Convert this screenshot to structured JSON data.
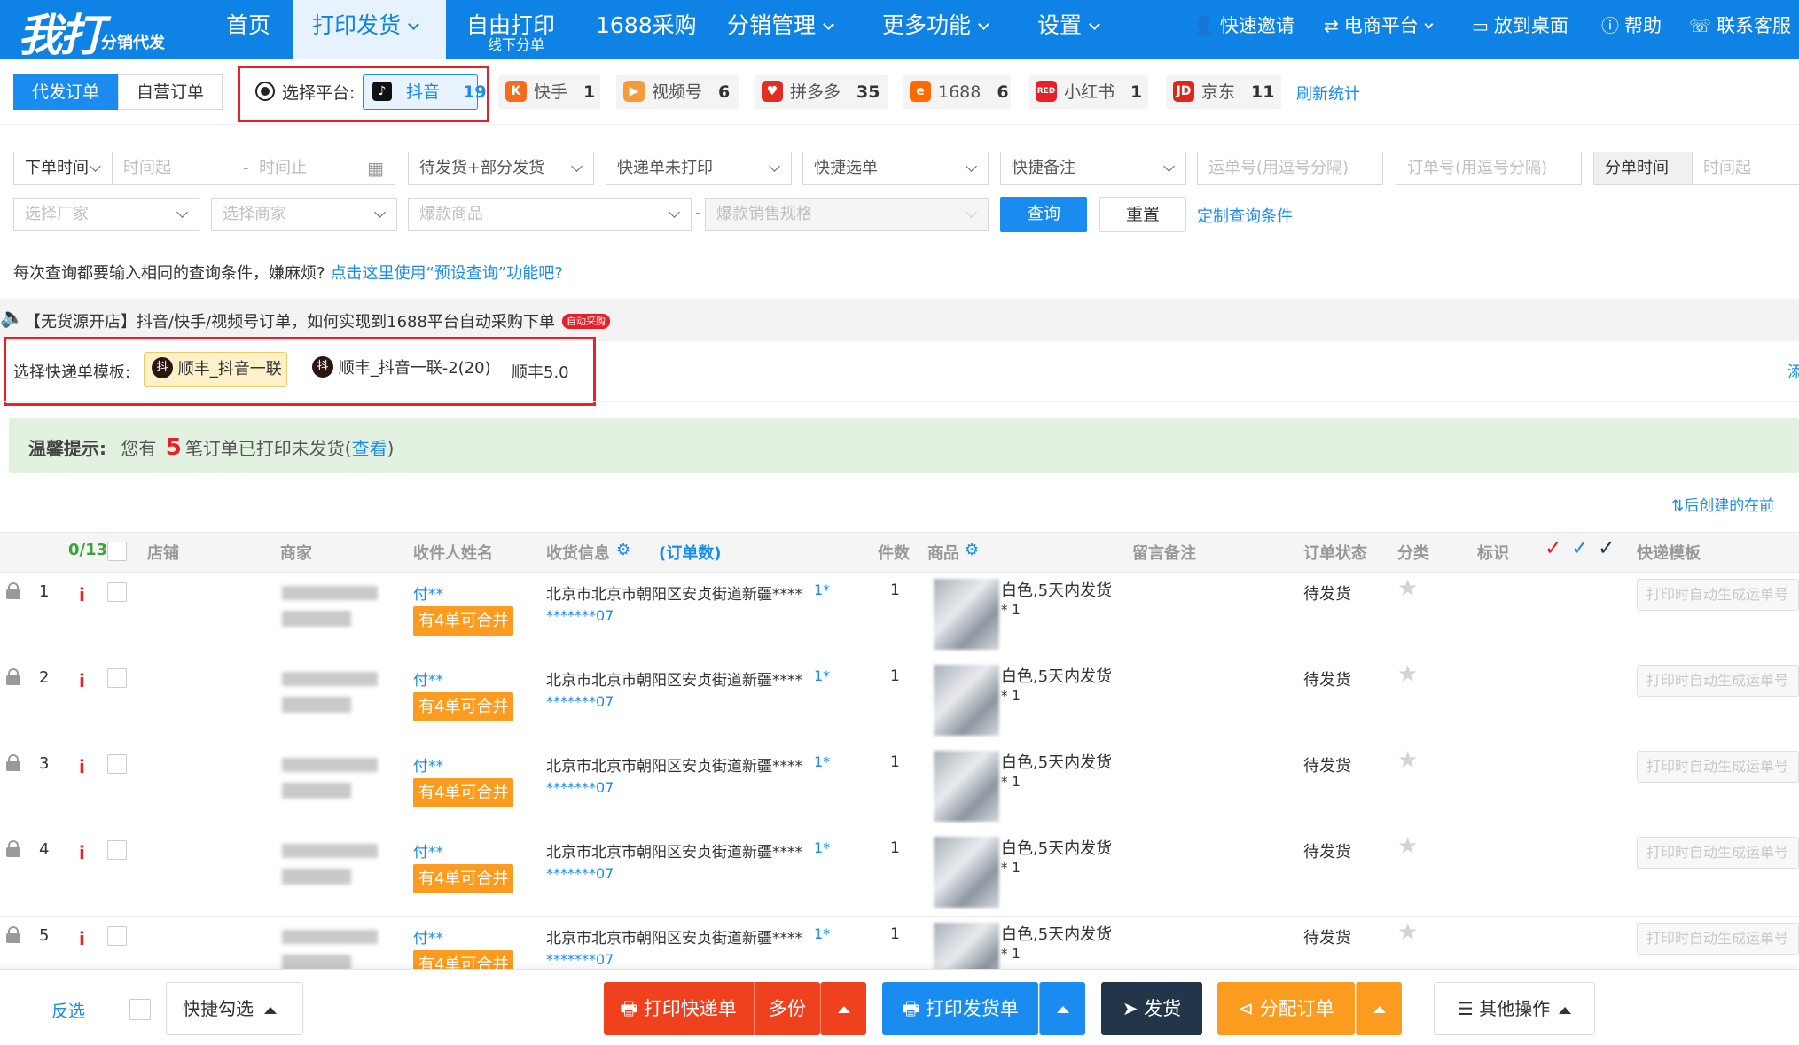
{
  "app": {
    "logo_main": "我打",
    "logo_sub": "分销代发"
  },
  "nav": {
    "items": [
      {
        "label": "首页"
      },
      {
        "label": "打印发货",
        "active": true
      },
      {
        "label": "自由打印",
        "sub": "线下分单"
      },
      {
        "label": "1688采购"
      },
      {
        "label": "分销管理"
      },
      {
        "label": "更多功能"
      },
      {
        "label": "设置"
      }
    ],
    "right": [
      {
        "label": "快速邀请",
        "icon": "user-plus-icon"
      },
      {
        "label": "电商平台",
        "icon": "swap-icon"
      },
      {
        "label": "放到桌面",
        "icon": "monitor-icon"
      },
      {
        "label": "帮助",
        "icon": "help-icon"
      },
      {
        "label": "联系客服",
        "icon": "headset-icon"
      }
    ]
  },
  "order_tabs": [
    "代发订单",
    "自营订单"
  ],
  "platform": {
    "label": "选择平台:",
    "selected": {
      "name": "抖音",
      "count": "19"
    },
    "others": [
      {
        "name": "快手",
        "count": "1",
        "color": "#f76b1c"
      },
      {
        "name": "视频号",
        "count": "6",
        "color": "#f79b3a"
      },
      {
        "name": "拼多多",
        "count": "35",
        "color": "#e02e24"
      },
      {
        "name": "1688",
        "count": "6",
        "color": "#ff6a00"
      },
      {
        "name": "小红书",
        "count": "1",
        "color": "#e8202a"
      },
      {
        "name": "京东",
        "count": "11",
        "color": "#e1251b"
      }
    ],
    "refresh": "刷新统计"
  },
  "filters": {
    "order_time": "下单时间",
    "time_start": "时间起",
    "time_end": "时间止",
    "ship_status": "待发货+部分发货",
    "print_status": "快递单未打印",
    "quick_select": "快捷选单",
    "quick_note": "快捷备注",
    "waybill_ph": "运单号(用逗号分隔)",
    "order_no_ph": "订单号(用逗号分隔)",
    "split_time": "分单时间",
    "split_time_start": "时间起",
    "factory_ph": "选择厂家",
    "merchant_ph": "选择商家",
    "hot_product_ph": "爆款商品",
    "hot_spec_ph": "爆款销售规格",
    "query": "查询",
    "reset": "重置",
    "custom": "定制查询条件"
  },
  "preset_tip": {
    "text": "每次查询都要输入相同的查询条件，嫌麻烦?",
    "link": "点击这里使用“预设查询”功能吧?"
  },
  "announce": {
    "text": "【无货源开店】抖音/快手/视频号订单，如何实现到1688平台自动采购下单",
    "badge": "自动采购"
  },
  "template": {
    "label": "选择快递单模板:",
    "items": [
      "顺丰_抖音一联",
      "顺丰_抖音一联-2(20)",
      "顺丰5.0"
    ],
    "more": "添"
  },
  "notice": {
    "title": "温馨提示:",
    "pre": "您有",
    "count": "5",
    "post": "笔订单已打印未发货(",
    "link": "查看",
    "close": ")"
  },
  "sort_link": "后创建的在前",
  "table": {
    "selected": "0/13",
    "headers": {
      "shop": "店铺",
      "merchant": "商家",
      "receiver": "收件人姓名",
      "address": "收货信息",
      "order_count": "(订单数)",
      "qty": "件数",
      "product": "商品",
      "remark": "留言备注",
      "status": "订单状态",
      "category": "分类",
      "flag": "标识",
      "template": "快递模板"
    },
    "rows": [
      {
        "no": "1",
        "receiver": "付**",
        "merge": "有4单可合并",
        "address": "北京市北京市朝阳区安贞街道新疆****",
        "addr_count": "1*",
        "phone": "*******07",
        "qty": "1",
        "spec": "白色,5天内发货",
        "spec_qty": "* 1",
        "status": "待发货",
        "auto": "打印时自动生成运单号"
      },
      {
        "no": "2",
        "receiver": "付**",
        "merge": "有4单可合并",
        "address": "北京市北京市朝阳区安贞街道新疆****",
        "addr_count": "1*",
        "phone": "*******07",
        "qty": "1",
        "spec": "白色,5天内发货",
        "spec_qty": "* 1",
        "status": "待发货",
        "auto": "打印时自动生成运单号"
      },
      {
        "no": "3",
        "receiver": "付**",
        "merge": "有4单可合并",
        "address": "北京市北京市朝阳区安贞街道新疆****",
        "addr_count": "1*",
        "phone": "*******07",
        "qty": "1",
        "spec": "白色,5天内发货",
        "spec_qty": "* 1",
        "status": "待发货",
        "auto": "打印时自动生成运单号"
      },
      {
        "no": "4",
        "receiver": "付**",
        "merge": "有4单可合并",
        "address": "北京市北京市朝阳区安贞街道新疆****",
        "addr_count": "1*",
        "phone": "*******07",
        "qty": "1",
        "spec": "白色,5天内发货",
        "spec_qty": "* 1",
        "status": "待发货",
        "auto": "打印时自动生成运单号"
      },
      {
        "no": "5",
        "receiver": "付**",
        "merge": "有4单可合并",
        "address": "北京市北京市朝阳区安贞街道新疆****",
        "addr_count": "1*",
        "phone": "*******07",
        "qty": "1",
        "spec": "白色,5天内发货",
        "spec_qty": "* 1",
        "status": "待发货",
        "auto": "打印时自动生成运单号"
      }
    ]
  },
  "bottom": {
    "invert": "反选",
    "quick_check": "快捷勾选",
    "print_waybill": "打印快递单",
    "multi": "多份",
    "print_invoice": "打印发货单",
    "ship": "发货",
    "assign": "分配订单",
    "other": "其他操作"
  },
  "colors": {
    "primary": "#0f82e6",
    "red": "#e8202a",
    "orange": "#fb9b1f",
    "dark": "#233649"
  }
}
